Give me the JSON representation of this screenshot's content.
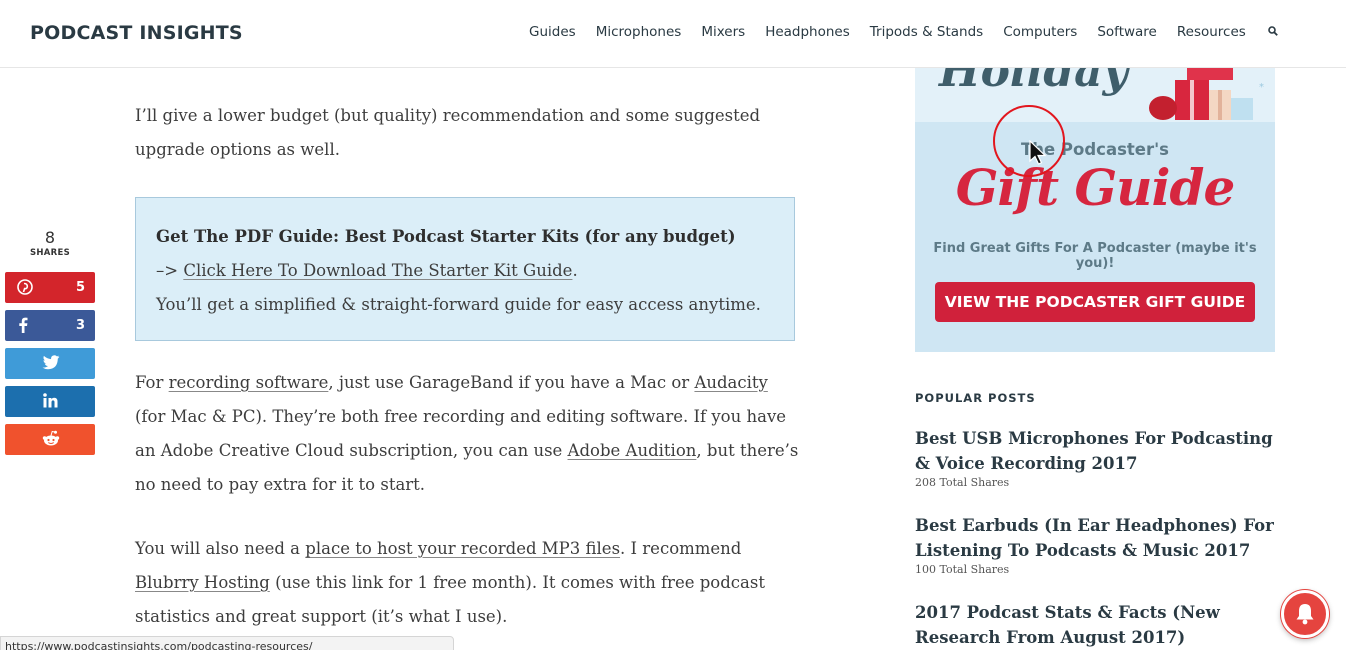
{
  "header": {
    "logo": "PODCAST INSIGHTS",
    "nav": [
      "Guides",
      "Microphones",
      "Mixers",
      "Headphones",
      "Tripods & Stands",
      "Computers",
      "Software",
      "Resources"
    ],
    "search_icon": "search-icon"
  },
  "share": {
    "count": "8",
    "label": "SHARES",
    "buttons": [
      {
        "network": "pinterest",
        "icon": "pinterest-icon",
        "count": "5",
        "color": "#d3252b"
      },
      {
        "network": "facebook",
        "icon": "facebook-icon",
        "count": "3",
        "color": "#3b5998"
      },
      {
        "network": "twitter",
        "icon": "twitter-icon",
        "count": "",
        "color": "#3f9bd8"
      },
      {
        "network": "linkedin",
        "icon": "linkedin-icon",
        "count": "",
        "color": "#1c6fae"
      },
      {
        "network": "reddit",
        "icon": "reddit-icon",
        "count": "",
        "color": "#f0522d"
      }
    ]
  },
  "article": {
    "p1": "I’ll give a lower budget (but quality) recommendation and some suggested upgrade options as well.",
    "callout_title": "Get The PDF Guide: Best Podcast Starter Kits (for any budget)",
    "callout_arrow": "–> ",
    "callout_link": "Click Here To Download The Starter Kit Guide",
    "callout_period": ".",
    "callout_line3": "You’ll get a simplified & straight-forward guide for easy access anytime.",
    "p2_a": "For ",
    "p2_link1": "recording software",
    "p2_b": ", just use GarageBand if you have a Mac or ",
    "p2_link2": "Audacity",
    "p2_c": " (for Mac & PC). They’re both free recording and editing software. If you have an Adobe Creative Cloud subscription, you can use ",
    "p2_link3": "Adobe Audition",
    "p2_d": ", but there’s no need to pay extra for it to start.",
    "p3_a": "You will also need a ",
    "p3_link1": "place to host your recorded MP3 files",
    "p3_b": ". I recommend ",
    "p3_link2": "Blubrry Hosting",
    "p3_c": " (use this link for 1 free month). It comes with free podcast statistics and great support (it’s what I use)."
  },
  "ad": {
    "holiday": "Holiday",
    "sub": "The Podcaster's",
    "title": "Gift Guide",
    "tag": "Find Great Gifts For A Podcaster (maybe it's you)!",
    "button": "VIEW THE PODCASTER GIFT GUIDE"
  },
  "popular": {
    "heading": "POPULAR POSTS",
    "items": [
      {
        "title": "Best USB Microphones For Podcasting & Voice Recording 2017",
        "shares": "208 Total Shares"
      },
      {
        "title": "Best Earbuds (In Ear Headphones) For Listening To Podcasts & Music 2017",
        "shares": "100 Total Shares"
      },
      {
        "title": "2017 Podcast Stats & Facts (New Research From August 2017)",
        "shares": ""
      }
    ]
  },
  "status_url": "https://www.podcastinsights.com/podcasting-resources/",
  "bell_icon": "bell-icon"
}
